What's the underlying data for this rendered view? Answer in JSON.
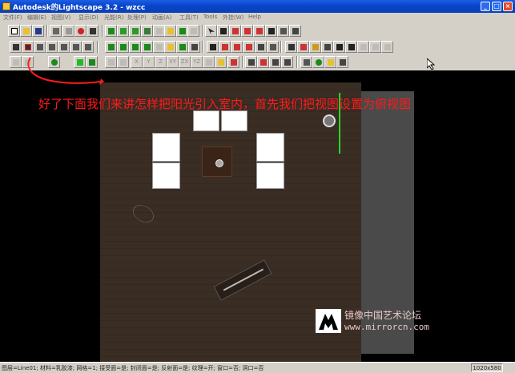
{
  "window": {
    "title": "Autodesk的Lightscape 3.2  - wzcc",
    "min": "_",
    "max": "□",
    "close": "×"
  },
  "menu": [
    "文件(F)",
    "编辑(E)",
    "视图(V)",
    "显示(D)",
    "光能(R)",
    "处理(P)",
    "动画(A)",
    "工具(T)",
    "Tools",
    "外挂(W)",
    "Help"
  ],
  "toolbar3_labels": [
    "X",
    "Y",
    "Z",
    "XY",
    "ZX",
    "YZ"
  ],
  "overlay_text": "好了下面我们来讲怎样把阳光引入室内，首先我们把视图设置为俯视图",
  "watermark": {
    "cn": "镜像中国艺术论坛",
    "url": "www.mirrorcn.com"
  },
  "status": {
    "text": "图层=Line01; 材料=乳胶漆; 网格=1; 接受面=是; 封闭面=是; 反射面=是; 纹理=开; 窗口=否; 洞口=否",
    "size": "1020x580"
  },
  "colors": {
    "overlay": "#ff1a1a",
    "titlebar": "#0a46c8",
    "light_line": "#2bd42b"
  }
}
